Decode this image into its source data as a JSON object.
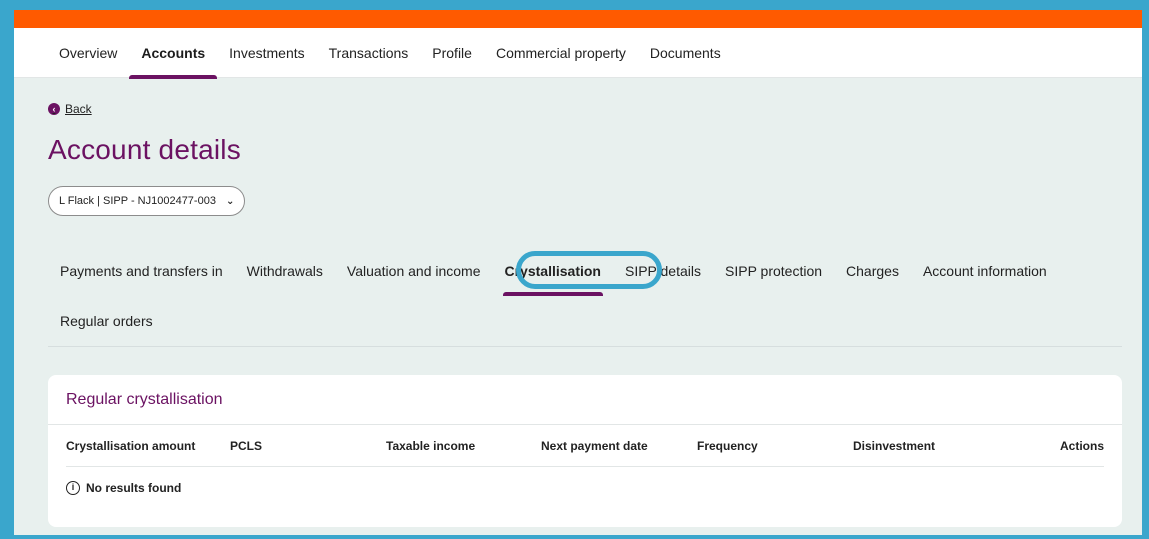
{
  "nav": {
    "items": [
      "Overview",
      "Accounts",
      "Investments",
      "Transactions",
      "Profile",
      "Commercial property",
      "Documents"
    ],
    "active": "Accounts"
  },
  "back_label": "Back",
  "page_title": "Account details",
  "account_select": {
    "value": "L Flack | SIPP - NJ1002477-003"
  },
  "subtabs": {
    "items": [
      "Payments and transfers in",
      "Withdrawals",
      "Valuation and income",
      "Crystallisation",
      "SIPP details",
      "SIPP protection",
      "Charges",
      "Account information",
      "Regular orders"
    ],
    "active": "Crystallisation"
  },
  "card": {
    "title": "Regular crystallisation",
    "columns": [
      "Crystallisation amount",
      "PCLS",
      "Taxable income",
      "Next payment date",
      "Frequency",
      "Disinvestment",
      "Actions"
    ],
    "empty_message": "No results found"
  },
  "colors": {
    "brand_orange": "#ff5a00",
    "brand_purple": "#6b1262",
    "highlight": "#3aa6cc"
  }
}
